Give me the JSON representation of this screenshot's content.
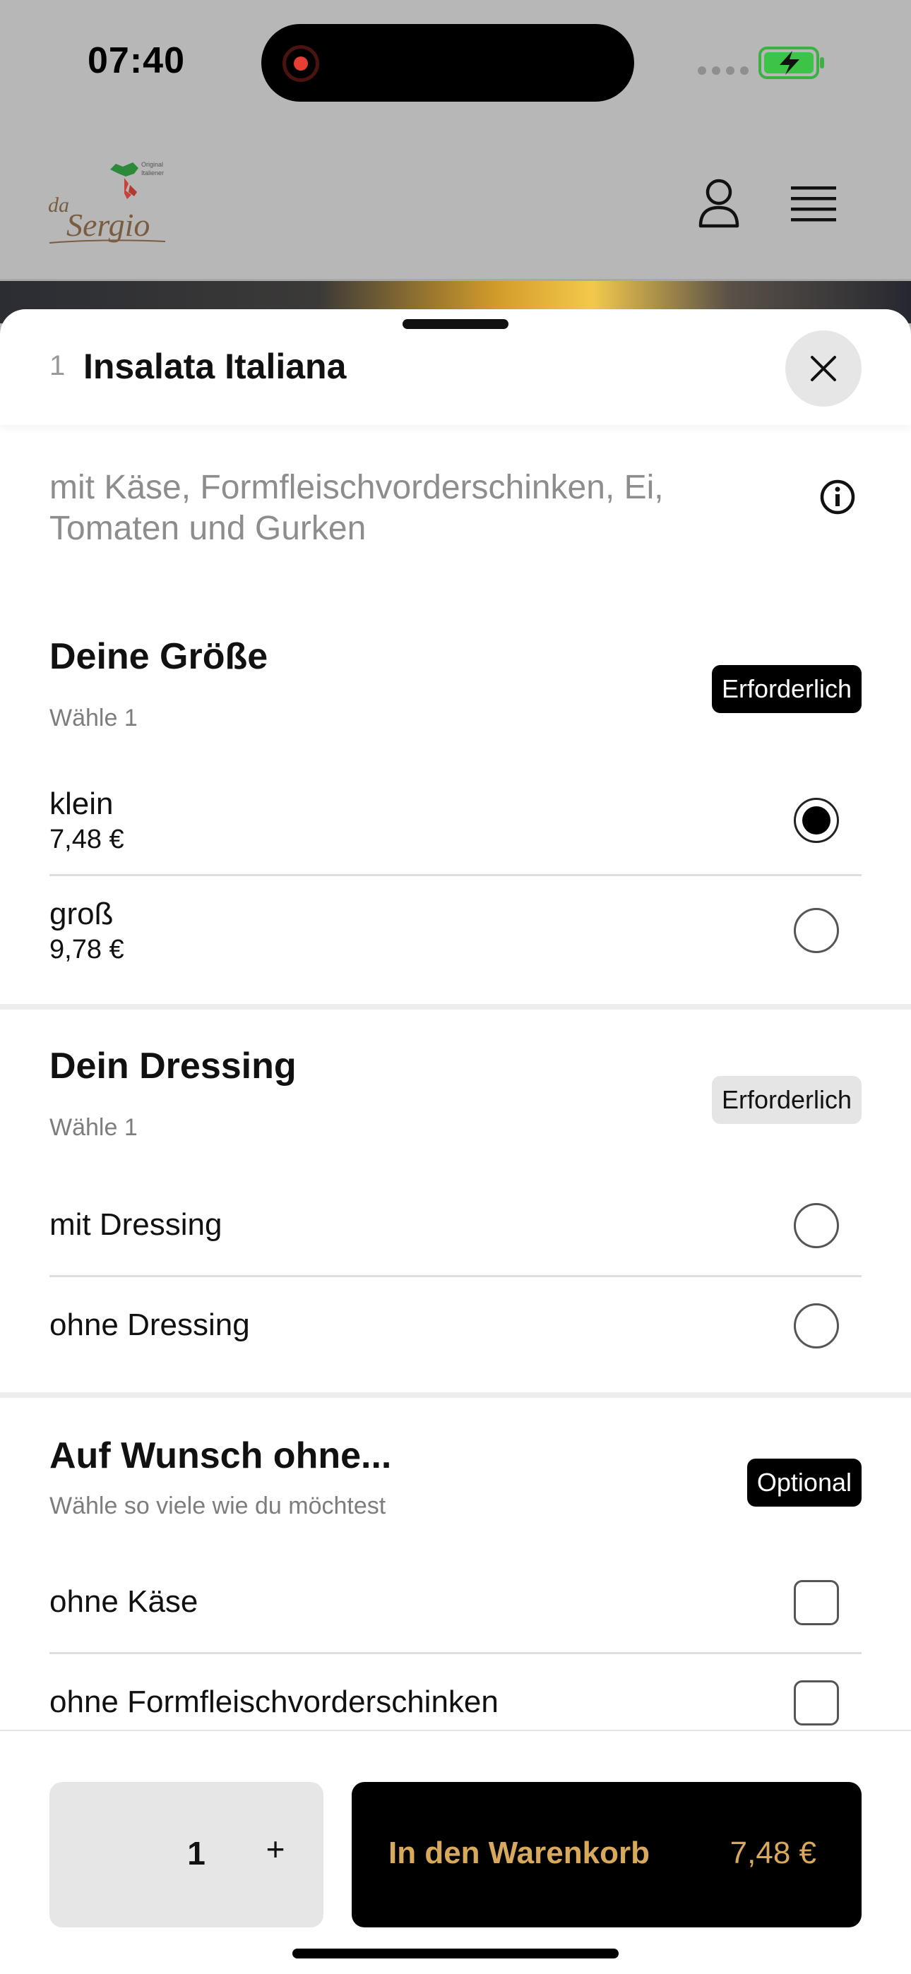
{
  "status_bar": {
    "time": "07:40"
  },
  "header": {
    "logo_script": "da Sergio",
    "logo_tagline": "Original Italiener"
  },
  "item": {
    "number": "1",
    "title": "Insalata Italiana",
    "description": "mit Käse, Formfleischvorderschinken, Ei, Tomaten und Gurken"
  },
  "sections": {
    "size": {
      "title": "Deine Größe",
      "subtitle": "Wähle 1",
      "badge": "Erforderlich",
      "options": [
        {
          "label": "klein",
          "price": "7,48 €",
          "selected": true
        },
        {
          "label": "groß",
          "price": "9,78 €",
          "selected": false
        }
      ]
    },
    "dressing": {
      "title": "Dein Dressing",
      "subtitle": "Wähle 1",
      "badge": "Erforderlich",
      "options": [
        {
          "label": "mit Dressing",
          "selected": false
        },
        {
          "label": "ohne Dressing",
          "selected": false
        }
      ]
    },
    "without": {
      "title": "Auf Wunsch ohne...",
      "subtitle": "Wähle so viele wie du möchtest",
      "badge": "Optional",
      "options": [
        {
          "label": "ohne Käse",
          "checked": false
        },
        {
          "label": "ohne Formfleischvorderschinken",
          "checked": false
        }
      ]
    }
  },
  "footer": {
    "quantity": "1",
    "plus": "+",
    "cart_label": "In den Warenkorb",
    "cart_price": "7,48 €"
  },
  "colors": {
    "accent_gold": "#d8a95a",
    "badge_dark": "#000000",
    "badge_light": "#e5e5e5"
  }
}
